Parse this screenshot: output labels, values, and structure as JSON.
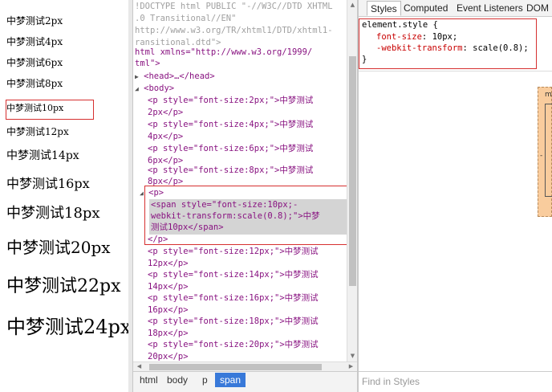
{
  "page": {
    "samples": [
      {
        "text": "中梦测试2px"
      },
      {
        "text": "中梦测试4px"
      },
      {
        "text": "中梦测试6px"
      },
      {
        "text": "中梦测试8px"
      },
      {
        "text": "中梦测试10px"
      },
      {
        "text": "中梦测试12px"
      },
      {
        "text": "中梦测试14px"
      },
      {
        "text": "中梦测试16px"
      },
      {
        "text": "中梦测试18px"
      },
      {
        "text": "中梦测试20px"
      },
      {
        "text": "中梦测试22px"
      },
      {
        "text": "中梦测试24px"
      }
    ]
  },
  "elements": {
    "doctype_1": "!DOCTYPE html PUBLIC \"-//W3C//DTD XHTML",
    "doctype_2": ".0 Transitional//EN\"",
    "doctype_3": "http://www.w3.org/TR/xhtml1/DTD/xhtml1-",
    "doctype_4": "ransitional.dtd\">",
    "html_open_1": "html xmlns=\"http://www.w3.org/1999/",
    "html_open_2": "tml\">",
    "head_collapsed": "<head>…</head>",
    "body_open": "<body>",
    "p_open": "<p>",
    "span_line_1": "<span style=\"font-size:10px;-",
    "span_line_2": "webkit-transform:scale(0.8);\">中梦",
    "span_line_3": "测试10px</span>",
    "p_close": "</p>",
    "p_items": [
      {
        "l1": "<p style=\"font-size:2px;\">中梦测试",
        "l2": "2px</p>"
      },
      {
        "l1": "<p style=\"font-size:4px;\">中梦测试",
        "l2": "4px</p>"
      },
      {
        "l1": "<p style=\"font-size:6px;\">中梦测试",
        "l2": "6px</p>"
      },
      {
        "l1": "<p style=\"font-size:8px;\">中梦测试",
        "l2": "8px</p>"
      },
      {
        "l1": "<p style=\"font-size:12px;\">中梦测试",
        "l2": "12px</p>"
      },
      {
        "l1": "<p style=\"font-size:14px;\">中梦测试",
        "l2": "14px</p>"
      },
      {
        "l1": "<p style=\"font-size:16px;\">中梦测试",
        "l2": "16px</p>"
      },
      {
        "l1": "<p style=\"font-size:18px;\">中梦测试",
        "l2": "18px</p>"
      },
      {
        "l1": "<p style=\"font-size:20px;\">中梦测试",
        "l2": "20px</p>"
      }
    ]
  },
  "breadcrumbs": [
    "html",
    "body",
    "p",
    "span"
  ],
  "sidebar": {
    "tabs": [
      "Styles",
      "Computed",
      "Event Listeners",
      "DOM"
    ],
    "rule": {
      "selector": "element.style {",
      "prop1_name": "font-size",
      "prop1_value": "10px;",
      "prop2_name": "-webkit-transform",
      "prop2_value": "scale(0.8);",
      "close": "}"
    },
    "boxmodel_label": "m",
    "boxmodel_dash": "-",
    "find_placeholder": "Find in Styles"
  },
  "colors": {
    "highlight": "#d63030",
    "selected_crumb": "#3879d9",
    "boxmodel_margin": "#f9cc9d"
  }
}
